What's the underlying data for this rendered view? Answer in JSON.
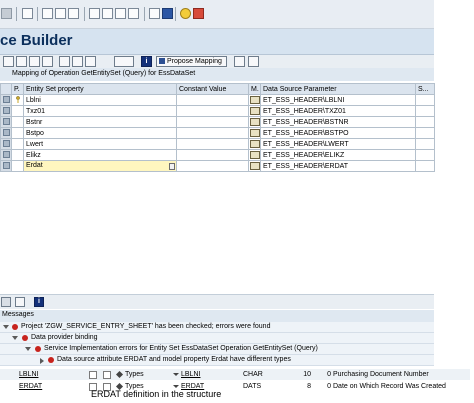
{
  "window": {
    "title": "ce Builder"
  },
  "mapping": {
    "header": "Mapping of Operation GetEntitySet (Query) for EssDataSet",
    "propose_label": "Propose Mapping",
    "columns": [
      "P.",
      "Entity Set property",
      "Constant Value",
      "M.",
      "Data Source Parameter",
      "S..."
    ],
    "rows": [
      {
        "entity": "Lblni",
        "param": "ET_ESS_HEADER\\LBLNI"
      },
      {
        "entity": "Txz01",
        "param": "ET_ESS_HEADER\\TXZ01"
      },
      {
        "entity": "Bstnr",
        "param": "ET_ESS_HEADER\\BSTNR"
      },
      {
        "entity": "Bstpo",
        "param": "ET_ESS_HEADER\\BSTPO"
      },
      {
        "entity": "Lwert",
        "param": "ET_ESS_HEADER\\LWERT"
      },
      {
        "entity": "Elikz",
        "param": "ET_ESS_HEADER\\ELIKZ"
      },
      {
        "entity": "Erdat",
        "param": "ET_ESS_HEADER\\ERDAT"
      }
    ]
  },
  "messages": {
    "header": "Messages",
    "lines": [
      "Project 'ZGW_SERVICE_ENTRY_SHEET' has been checked; errors were found",
      "Data provider binding",
      "Service Implementation errors for Entity Set EssDataSet Operation GetEntitySet (Query)",
      "Data source attribute ERDAT and model property Erdat have different types"
    ]
  },
  "structure": {
    "rows": [
      {
        "name": "LBLNI",
        "type_label": "Types",
        "type_name": "LBLNI",
        "dtype": "CHAR",
        "len": "10",
        "dec": "0",
        "desc": "Purchasing Document Number"
      },
      {
        "name": "ERDAT",
        "type_label": "Types",
        "type_name": "ERDAT",
        "dtype": "DATS",
        "len": "8",
        "dec": "0",
        "desc": "Date on Which Record Was Created"
      }
    ]
  },
  "caption": "ERDAT definition in the structure",
  "colors": {
    "accent": "#0b2f5c",
    "error": "#c7231d",
    "active_row": "#fff6bf"
  }
}
